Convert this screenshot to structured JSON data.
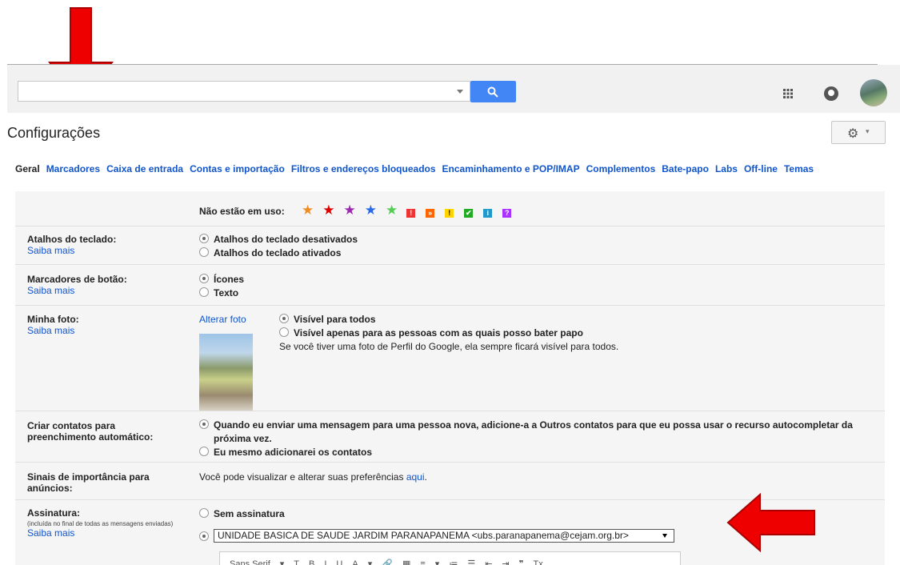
{
  "header": {
    "search_placeholder": "",
    "icons": [
      "search-icon",
      "apps-grid-icon",
      "notifications-icon",
      "avatar"
    ]
  },
  "page": {
    "title": "Configurações",
    "settings_icon": "⚙",
    "settings_caret": "▾"
  },
  "tabs": [
    "Geral",
    "Marcadores",
    "Caixa de entrada",
    "Contas e importação",
    "Filtros e endereços bloqueados",
    "Encaminhamento e POP/IMAP",
    "Complementos",
    "Bate-papo",
    "Labs",
    "Off-line",
    "Temas"
  ],
  "settings": {
    "unused_label": "Não estão em uso:",
    "stars": [
      "#f28b20",
      "#d00",
      "#9c27b0",
      "#2a6ae9",
      "#5c5"
    ],
    "badges": [
      {
        "glyph": "!",
        "bg": "#e33",
        "fg": "#fff"
      },
      {
        "glyph": "»",
        "bg": "#f60",
        "fg": "#fff"
      },
      {
        "glyph": "!",
        "bg": "#ffd400",
        "fg": "#000"
      },
      {
        "glyph": "✔",
        "bg": "#2a2",
        "fg": "#fff"
      },
      {
        "glyph": "i",
        "bg": "#29c",
        "fg": "#fff"
      },
      {
        "glyph": "?",
        "bg": "#a3f",
        "fg": "#fff"
      }
    ],
    "shortcuts": {
      "label": "Atalhos do teclado:",
      "learn": "Saiba mais",
      "opt1": "Atalhos do teclado desativados",
      "opt2": "Atalhos do teclado ativados"
    },
    "button_labels": {
      "label": "Marcadores de botão:",
      "learn": "Saiba mais",
      "opt1": "Ícones",
      "opt2": "Texto"
    },
    "photo": {
      "label": "Minha foto:",
      "learn": "Saiba mais",
      "change": "Alterar foto",
      "opt1": "Visível para todos",
      "opt2": "Visível apenas para as pessoas com as quais posso bater papo",
      "note": "Se você tiver uma foto de Perfil do Google, ela sempre ficará visível para todos."
    },
    "contacts": {
      "label1": "Criar contatos para",
      "label2": "preenchimento automático:",
      "opt1a": "Quando eu enviar uma mensagem para uma pessoa nova, adicione-a a Outros contatos para que eu possa usar o recurso autocompletar da",
      "opt1b": "próxima vez.",
      "opt2": "Eu mesmo adicionarei os contatos"
    },
    "ads": {
      "label1": "Sinais de importância para",
      "label2": "anúncios:",
      "text": "Você pode visualizar e alterar suas preferências ",
      "link": "aqui",
      "end": "."
    },
    "signature": {
      "label": "Assinatura:",
      "sub": "(incluída no final de todas as mensagens enviadas)",
      "learn": "Saiba mais",
      "opt1": "Sem assinatura",
      "selected": "UNIDADE BASICA DE SAUDE JARDIM PARANAPANEMA <ubs.paranapanema@cejam.org.br>"
    },
    "editor_toolbar": [
      "Sans Serif",
      "▾",
      "T",
      "B",
      "I",
      "U",
      "A",
      "▾",
      "🔗",
      "▦",
      "≡",
      "▾",
      "≔",
      "☰",
      "⇤",
      "⇥",
      "❞",
      "Tx"
    ]
  },
  "annotations": {
    "arrow_color": "#e00"
  }
}
